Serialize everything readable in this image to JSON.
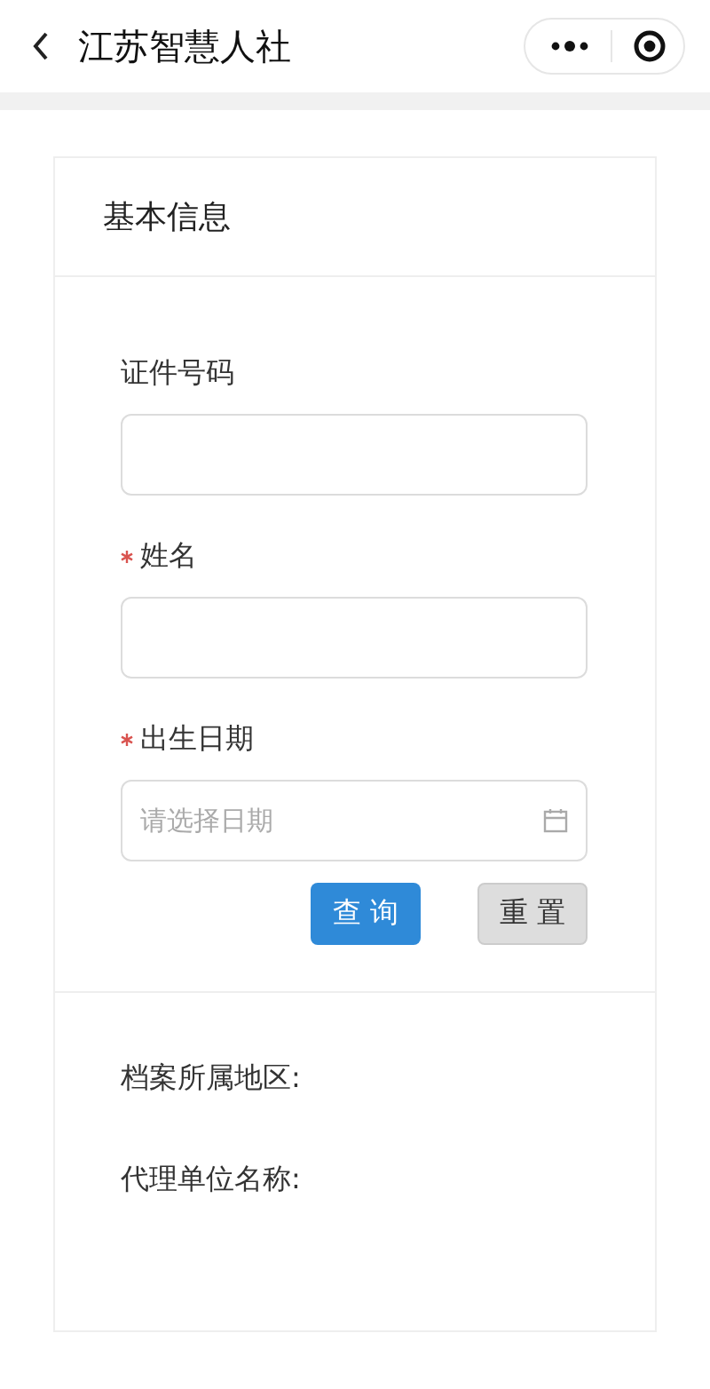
{
  "header": {
    "title": "江苏智慧人社"
  },
  "card": {
    "title": "基本信息",
    "fields": [
      {
        "label": "证件号码",
        "required": false,
        "kind": "text"
      },
      {
        "label": "姓名",
        "required": true,
        "kind": "text"
      },
      {
        "label": "出生日期",
        "required": true,
        "kind": "date",
        "placeholder": "请选择日期"
      }
    ],
    "buttons": [
      {
        "label": "查 询",
        "kind": "primary"
      },
      {
        "label": "重 置",
        "kind": "default"
      }
    ],
    "info": [
      {
        "label": "档案所属地区:"
      },
      {
        "label": "代理单位名称:"
      }
    ]
  }
}
